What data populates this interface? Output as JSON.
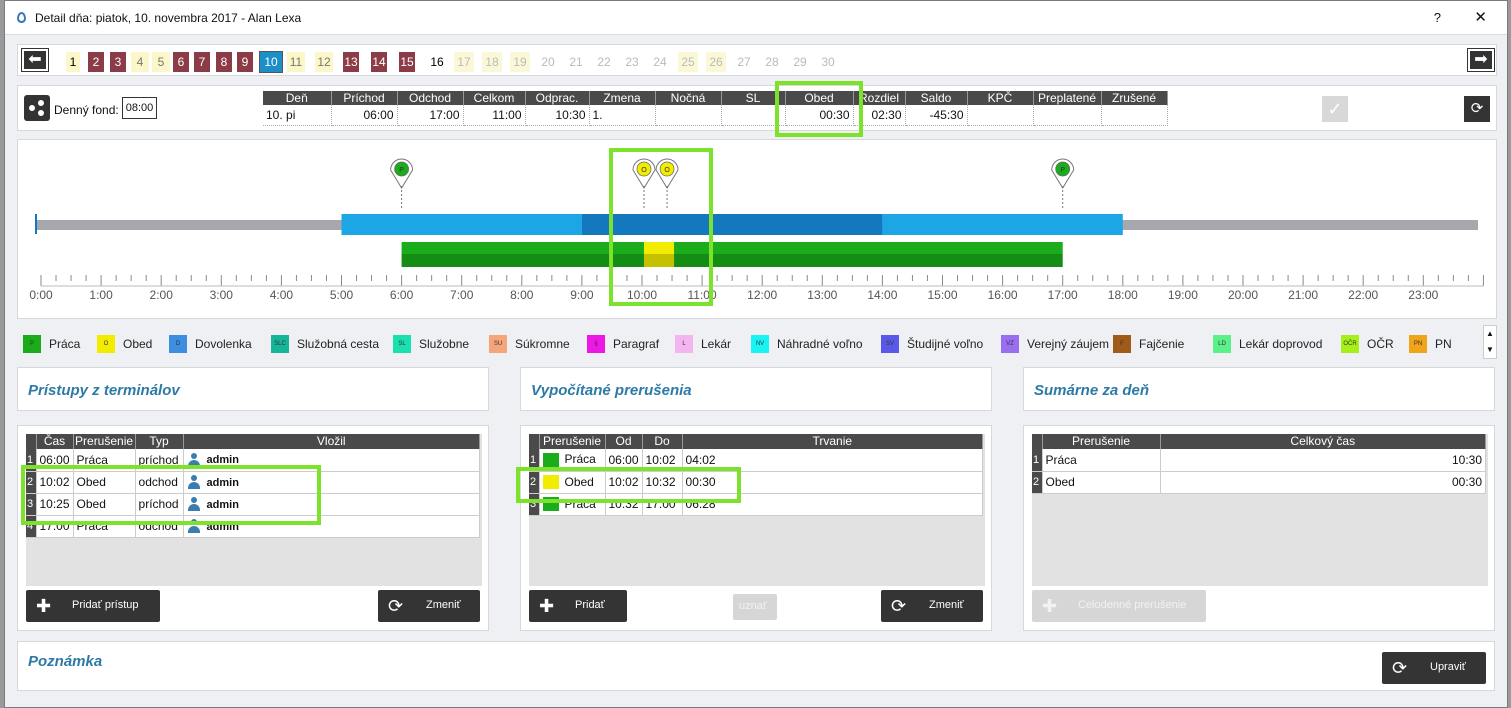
{
  "title": "Detail dňa: piatok, 10. novembra 2017 -  Alan Lexa",
  "help": "?",
  "close": "✕",
  "days": [
    {
      "n": "1",
      "k": "cur"
    },
    {
      "n": "2",
      "k": "red"
    },
    {
      "n": "3",
      "k": "red"
    },
    {
      "n": "4",
      "k": "yel"
    },
    {
      "n": "5",
      "k": "yel"
    },
    {
      "n": "6",
      "k": "red"
    },
    {
      "n": "7",
      "k": "red"
    },
    {
      "n": "8",
      "k": "red"
    },
    {
      "n": "9",
      "k": "red"
    },
    {
      "n": "10",
      "k": "blue"
    },
    {
      "n": "11",
      "k": "yel"
    },
    {
      "n": "12",
      "k": "yel"
    },
    {
      "n": "13",
      "k": "red"
    },
    {
      "n": "14",
      "k": "red"
    },
    {
      "n": "15",
      "k": "red"
    },
    {
      "n": "16",
      "k": "blk"
    },
    {
      "n": "17",
      "k": "pyel"
    },
    {
      "n": "18",
      "k": "pyel"
    },
    {
      "n": "19",
      "k": "pyel"
    },
    {
      "n": "20",
      "k": "plain"
    },
    {
      "n": "21",
      "k": "plain"
    },
    {
      "n": "22",
      "k": "plain"
    },
    {
      "n": "23",
      "k": "plain"
    },
    {
      "n": "24",
      "k": "plain"
    },
    {
      "n": "25",
      "k": "pyel"
    },
    {
      "n": "26",
      "k": "pyel"
    },
    {
      "n": "27",
      "k": "plain"
    },
    {
      "n": "28",
      "k": "plain"
    },
    {
      "n": "29",
      "k": "plain"
    },
    {
      "n": "30",
      "k": "plain"
    }
  ],
  "summary": {
    "fond_label": "Denný fond:",
    "fond_value": "08:00",
    "headers": [
      "Deň",
      "Príchod",
      "Odchod",
      "Celkom",
      "Odprac.",
      "Zmena",
      "Nočná",
      "SL",
      "Obed",
      "Rozdiel",
      "Saldo",
      "KPČ",
      "Preplatené",
      "Zrušené"
    ],
    "row": [
      "10. pi",
      "06:00",
      "17:00",
      "11:00",
      "10:30",
      "1.",
      "",
      "",
      "00:30",
      "02:30",
      "-45:30",
      "",
      "",
      ""
    ]
  },
  "timeline": {
    "hours": [
      "0:00",
      "1:00",
      "2:00",
      "3:00",
      "4:00",
      "5:00",
      "6:00",
      "7:00",
      "8:00",
      "9:00",
      "10:00",
      "11:00",
      "12:00",
      "13:00",
      "14:00",
      "15:00",
      "16:00",
      "17:00",
      "18:00",
      "19:00",
      "20:00",
      "21:00",
      "22:00",
      "23:00"
    ],
    "fund_bars": [
      {
        "from": 5,
        "to": 9,
        "color": "#1da6e6"
      },
      {
        "from": 9,
        "to": 14,
        "color": "#1478be"
      },
      {
        "from": 14,
        "to": 18,
        "color": "#1da6e6"
      }
    ],
    "work_bars": [
      {
        "from": 6,
        "to": 10.033,
        "color": "#1aac1a"
      },
      {
        "from": 10.033,
        "to": 10.533,
        "color": "#f2ec00"
      },
      {
        "from": 10.533,
        "to": 17,
        "color": "#1aac1a"
      }
    ],
    "markers": [
      {
        "t": 6,
        "label": "P",
        "color": "#1aac1a"
      },
      {
        "t": 10.033,
        "label": "O",
        "color": "#f2ec00"
      },
      {
        "t": 10.417,
        "label": "O",
        "color": "#f2ec00"
      },
      {
        "t": 17,
        "label": "P",
        "color": "#1aac1a"
      }
    ]
  },
  "legend": [
    {
      "code": "P",
      "label": "Práca",
      "color": "#1aac1a"
    },
    {
      "code": "O",
      "label": "Obed",
      "color": "#f2ec00"
    },
    {
      "code": "D",
      "label": "Dovolenka",
      "color": "#3b8ee0"
    },
    {
      "code": "SLC",
      "label": "Služobná cesta",
      "color": "#16b59a"
    },
    {
      "code": "SL",
      "label": "Služobne",
      "color": "#1ae0b0"
    },
    {
      "code": "SU",
      "label": "Súkromne",
      "color": "#f4a57a"
    },
    {
      "code": "§",
      "label": "Paragraf",
      "color": "#ee18e6"
    },
    {
      "code": "L",
      "label": "Lekár",
      "color": "#f4b4f0"
    },
    {
      "code": "NV",
      "label": "Náhradné voľno",
      "color": "#18f4f4"
    },
    {
      "code": "SV",
      "label": "Študijné voľno",
      "color": "#5a58e8"
    },
    {
      "code": "VZ",
      "label": "Verejný záujem",
      "color": "#9a6ef0"
    },
    {
      "code": "F",
      "label": "Fajčenie",
      "color": "#a05a1a"
    },
    {
      "code": "LD",
      "label": "Lekár doprovod",
      "color": "#5af08a"
    },
    {
      "code": "OČR",
      "label": "OČR",
      "color": "#a6f01a"
    },
    {
      "code": "PN",
      "label": "PN",
      "color": "#f0a41a"
    }
  ],
  "p1": {
    "title": "Prístupy z terminálov",
    "headers": [
      "Čas",
      "Prerušenie",
      "Typ",
      "Vložil"
    ],
    "rows": [
      {
        "n": "1",
        "time": "06:00",
        "int": "Práca",
        "type": "príchod",
        "user": "admin"
      },
      {
        "n": "2",
        "time": "10:02",
        "int": "Obed",
        "type": "odchod",
        "user": "admin"
      },
      {
        "n": "3",
        "time": "10:25",
        "int": "Obed",
        "type": "príchod",
        "user": "admin"
      },
      {
        "n": "4",
        "time": "17:00",
        "int": "Práca",
        "type": "odchod",
        "user": "admin"
      }
    ],
    "btn_add": "Pridať prístup",
    "btn_change": "Zmeniť"
  },
  "p2": {
    "title": "Vypočítané prerušenia",
    "headers": [
      "Prerušenie",
      "Od",
      "Do",
      "Trvanie"
    ],
    "rows": [
      {
        "n": "1",
        "int": "Práca",
        "color": "#1aac1a",
        "from": "06:00",
        "to": "10:02",
        "dur": "04:02"
      },
      {
        "n": "2",
        "int": "Obed",
        "color": "#f2ec00",
        "from": "10:02",
        "to": "10:32",
        "dur": "00:30"
      },
      {
        "n": "3",
        "int": "Práca",
        "color": "#1aac1a",
        "from": "10:32",
        "to": "17:00",
        "dur": "06:28"
      }
    ],
    "btn_add": "Pridať",
    "btn_accept": "uznať",
    "btn_change": "Zmeniť"
  },
  "p3": {
    "title": "Sumárne za deň",
    "headers": [
      "Prerušenie",
      "Celkový čas"
    ],
    "rows": [
      {
        "n": "1",
        "int": "Práca",
        "total": "10:30"
      },
      {
        "n": "2",
        "int": "Obed",
        "total": "00:30"
      }
    ],
    "btn_full": "Celodenné prerušenie"
  },
  "note": {
    "title": "Poznámka",
    "btn_edit": "Upraviť"
  }
}
